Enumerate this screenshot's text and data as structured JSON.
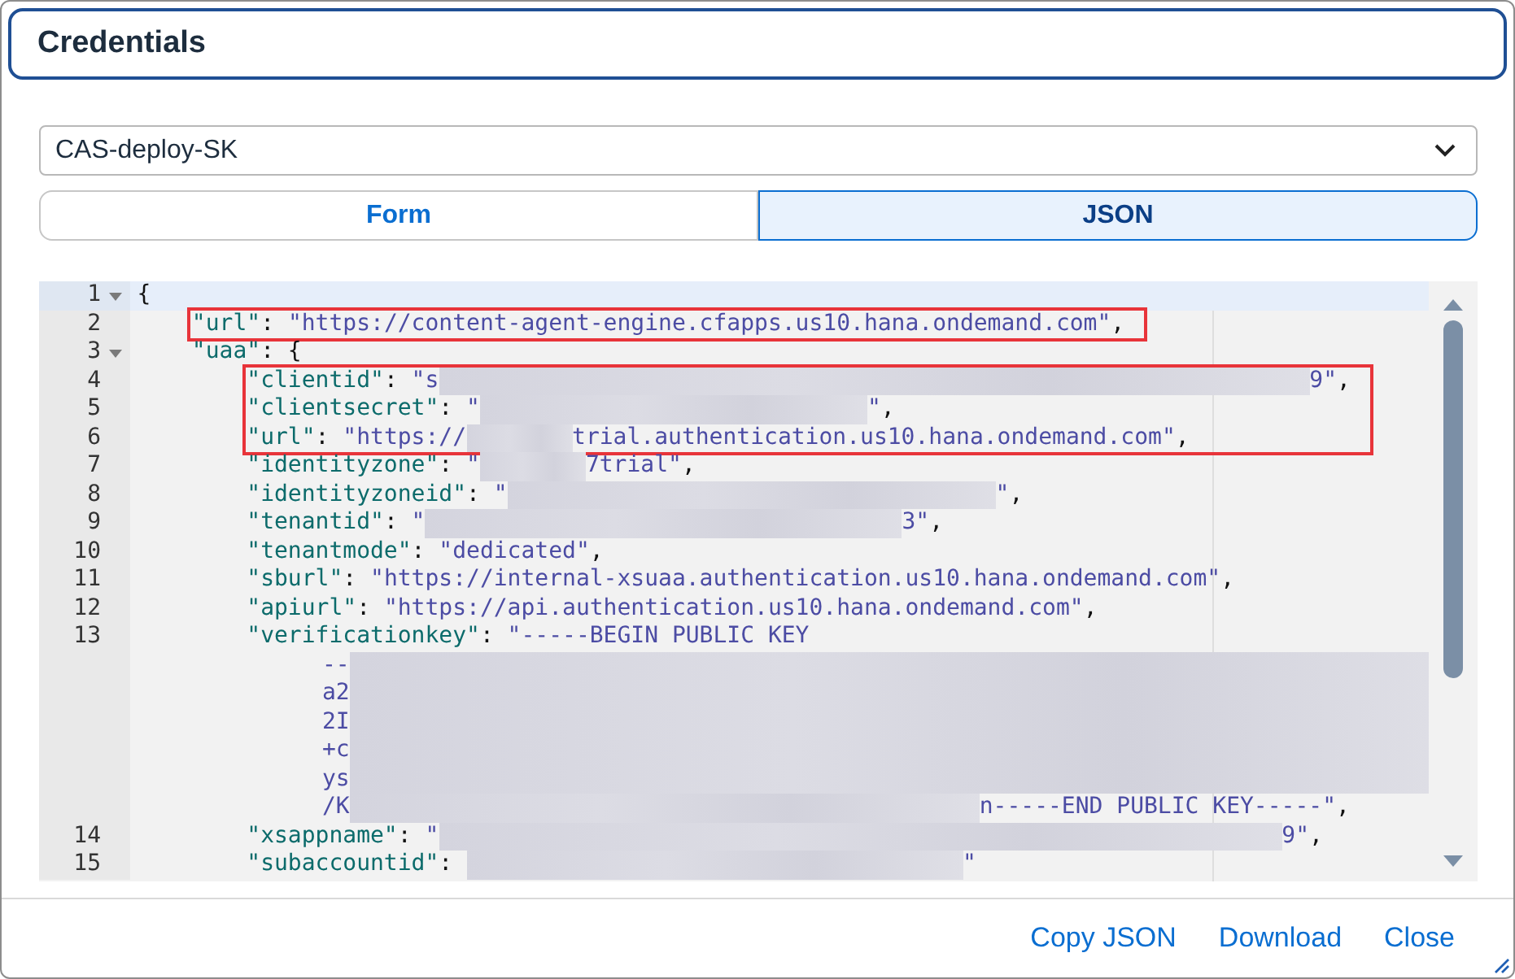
{
  "dialog": {
    "title": "Credentials"
  },
  "select": {
    "value": "CAS-deploy-SK"
  },
  "tabs": [
    {
      "label": "Form",
      "selected": false
    },
    {
      "label": "JSON",
      "selected": true
    }
  ],
  "editor": {
    "lines": [
      {
        "number": "1",
        "active": true,
        "foldable": true,
        "expanded": true,
        "annotated": false,
        "segments": [
          {
            "kind": "punct",
            "text": "{"
          }
        ],
        "children": [
          {
            "number": "2",
            "active": false,
            "foldable": false,
            "annotated": true,
            "segments": [
              {
                "kind": "key",
                "text": "\"url\""
              },
              {
                "kind": "punct",
                "text": ": "
              },
              {
                "kind": "string",
                "text": "\"https://content-agent-engine.cfapps.us10.hana.ondemand.com\""
              },
              {
                "kind": "punct",
                "text": ","
              }
            ]
          },
          {
            "number": "3",
            "active": false,
            "foldable": true,
            "expanded": true,
            "annotated": false,
            "segments": [
              {
                "kind": "key",
                "text": "\"uaa\""
              },
              {
                "kind": "punct",
                "text": ": {"
              }
            ],
            "children": [
              {
                "number": "4",
                "active": false,
                "foldable": false,
                "annotated": true,
                "segments": [
                  {
                    "kind": "key",
                    "text": "\"clientid\""
                  },
                  {
                    "kind": "punct",
                    "text": ": "
                  },
                  {
                    "kind": "string",
                    "text": "\"s"
                  },
                  {
                    "kind": "redacted"
                  },
                  {
                    "kind": "string",
                    "text": "9\""
                  },
                  {
                    "kind": "punct",
                    "text": ","
                  }
                ]
              },
              {
                "number": "5",
                "active": false,
                "foldable": false,
                "annotated": true,
                "segments": [
                  {
                    "kind": "key",
                    "text": "\"clientsecret\""
                  },
                  {
                    "kind": "punct",
                    "text": ": "
                  },
                  {
                    "kind": "string",
                    "text": "\""
                  },
                  {
                    "kind": "redacted"
                  },
                  {
                    "kind": "string",
                    "text": "\""
                  },
                  {
                    "kind": "punct",
                    "text": ","
                  }
                ]
              },
              {
                "number": "6",
                "active": false,
                "foldable": false,
                "annotated": true,
                "segments": [
                  {
                    "kind": "key",
                    "text": "\"url\""
                  },
                  {
                    "kind": "punct",
                    "text": ": "
                  },
                  {
                    "kind": "string",
                    "text": "\"https://"
                  },
                  {
                    "kind": "redacted"
                  },
                  {
                    "kind": "string",
                    "text": "trial.authentication.us10.hana.ondemand.com\""
                  },
                  {
                    "kind": "punct",
                    "text": ","
                  }
                ]
              },
              {
                "number": "7",
                "active": false,
                "foldable": false,
                "annotated": false,
                "segments": [
                  {
                    "kind": "key",
                    "text": "\"identityzone\""
                  },
                  {
                    "kind": "punct",
                    "text": ": "
                  },
                  {
                    "kind": "string",
                    "text": "\""
                  },
                  {
                    "kind": "redacted"
                  },
                  {
                    "kind": "string",
                    "text": "7trial\""
                  },
                  {
                    "kind": "punct",
                    "text": ","
                  }
                ]
              },
              {
                "number": "8",
                "active": false,
                "foldable": false,
                "annotated": false,
                "segments": [
                  {
                    "kind": "key",
                    "text": "\"identityzoneid\""
                  },
                  {
                    "kind": "punct",
                    "text": ": "
                  },
                  {
                    "kind": "string",
                    "text": "\""
                  },
                  {
                    "kind": "redacted"
                  },
                  {
                    "kind": "string",
                    "text": "\""
                  },
                  {
                    "kind": "punct",
                    "text": ","
                  }
                ]
              },
              {
                "number": "9",
                "active": false,
                "foldable": false,
                "annotated": false,
                "segments": [
                  {
                    "kind": "key",
                    "text": "\"tenantid\""
                  },
                  {
                    "kind": "punct",
                    "text": ": "
                  },
                  {
                    "kind": "string",
                    "text": "\""
                  },
                  {
                    "kind": "redacted"
                  },
                  {
                    "kind": "string",
                    "text": "3\""
                  },
                  {
                    "kind": "punct",
                    "text": ","
                  }
                ]
              },
              {
                "number": "10",
                "active": false,
                "foldable": false,
                "annotated": false,
                "segments": [
                  {
                    "kind": "key",
                    "text": "\"tenantmode\""
                  },
                  {
                    "kind": "punct",
                    "text": ": "
                  },
                  {
                    "kind": "string",
                    "text": "\"dedicated\""
                  },
                  {
                    "kind": "punct",
                    "text": ","
                  }
                ]
              },
              {
                "number": "11",
                "active": false,
                "foldable": false,
                "annotated": false,
                "segments": [
                  {
                    "kind": "key",
                    "text": "\"sburl\""
                  },
                  {
                    "kind": "punct",
                    "text": ": "
                  },
                  {
                    "kind": "string",
                    "text": "\"https://internal-xsuaa.authentication.us10.hana.ondemand.com\""
                  },
                  {
                    "kind": "punct",
                    "text": ","
                  }
                ]
              },
              {
                "number": "12",
                "active": false,
                "foldable": false,
                "annotated": false,
                "segments": [
                  {
                    "kind": "key",
                    "text": "\"apiurl\""
                  },
                  {
                    "kind": "punct",
                    "text": ": "
                  },
                  {
                    "kind": "string",
                    "text": "\"https://api.authentication.us10.hana.ondemand.com\""
                  },
                  {
                    "kind": "punct",
                    "text": ","
                  }
                ]
              },
              {
                "number": "13",
                "active": false,
                "foldable": false,
                "annotated": false,
                "segments": [
                  {
                    "kind": "key",
                    "text": "\"verificationkey\""
                  },
                  {
                    "kind": "punct",
                    "text": ": "
                  },
                  {
                    "kind": "string",
                    "text": "\"-----BEGIN PUBLIC KEY"
                  }
                ],
                "continuation": [
                  [
                    {
                      "kind": "string",
                      "text": "--"
                    },
                    {
                      "kind": "redacted"
                    }
                  ],
                  [
                    {
                      "kind": "string",
                      "text": "a2"
                    },
                    {
                      "kind": "redacted"
                    }
                  ],
                  [
                    {
                      "kind": "string",
                      "text": "2I"
                    },
                    {
                      "kind": "redacted"
                    }
                  ],
                  [
                    {
                      "kind": "string",
                      "text": "+c"
                    },
                    {
                      "kind": "redacted"
                    }
                  ],
                  [
                    {
                      "kind": "string",
                      "text": "ys"
                    },
                    {
                      "kind": "redacted"
                    }
                  ],
                  [
                    {
                      "kind": "string",
                      "text": "/K"
                    },
                    {
                      "kind": "redacted"
                    },
                    {
                      "kind": "string",
                      "text": "n-----END PUBLIC KEY-----\""
                    },
                    {
                      "kind": "punct",
                      "text": ","
                    }
                  ]
                ]
              },
              {
                "number": "14",
                "active": false,
                "foldable": false,
                "annotated": false,
                "segments": [
                  {
                    "kind": "key",
                    "text": "\"xsappname\""
                  },
                  {
                    "kind": "punct",
                    "text": ": "
                  },
                  {
                    "kind": "string",
                    "text": "\""
                  },
                  {
                    "kind": "redacted"
                  },
                  {
                    "kind": "string",
                    "text": "9\""
                  },
                  {
                    "kind": "punct",
                    "text": ","
                  }
                ]
              },
              {
                "number": "15",
                "active": false,
                "foldable": false,
                "annotated": false,
                "segments": [
                  {
                    "kind": "key",
                    "text": "\"subaccountid\""
                  },
                  {
                    "kind": "punct",
                    "text": ": "
                  },
                  {
                    "kind": "redacted"
                  },
                  {
                    "kind": "string",
                    "text": "\""
                  }
                ]
              }
            ]
          }
        ]
      }
    ]
  },
  "buttons": [
    "Copy JSON",
    "Download",
    "Close"
  ]
}
